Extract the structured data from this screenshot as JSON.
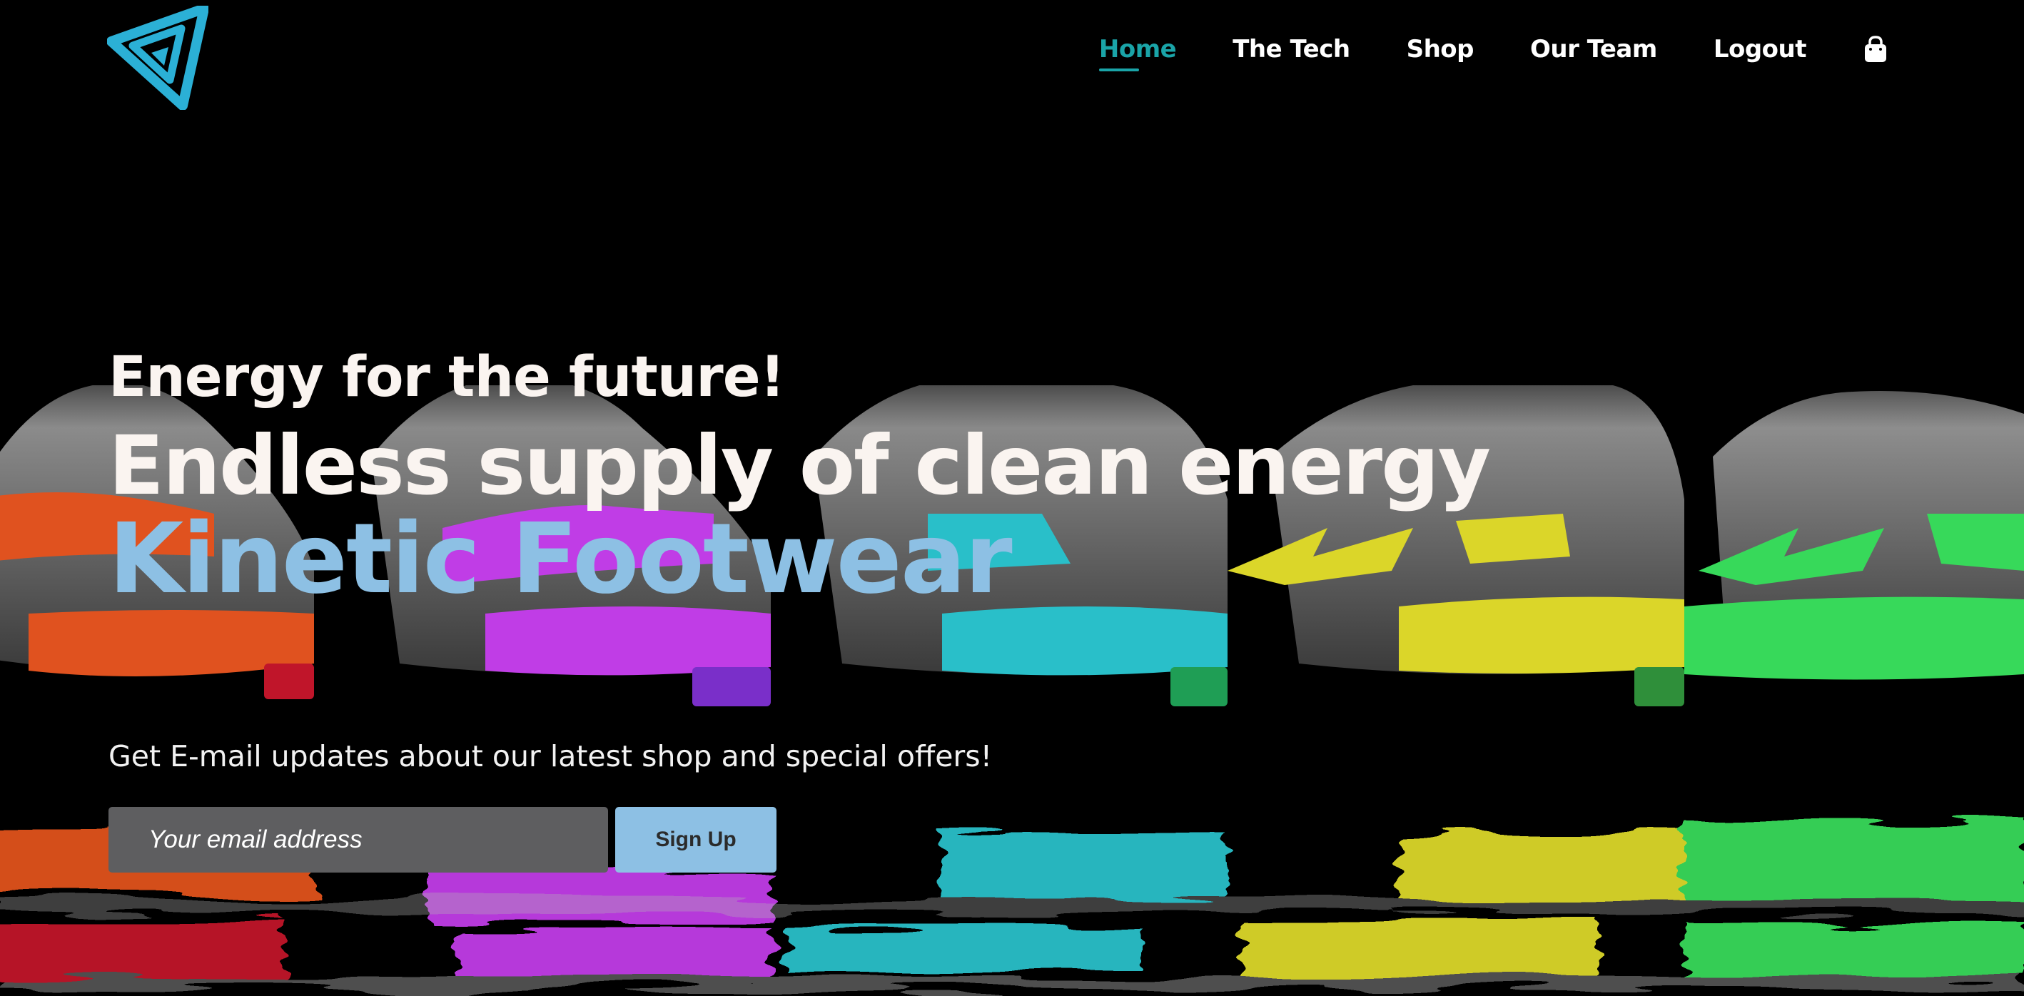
{
  "header": {
    "logo_icon": "triangle-swirl-logo",
    "nav": [
      {
        "label": "Home",
        "active": true
      },
      {
        "label": "The Tech",
        "active": false
      },
      {
        "label": "Shop",
        "active": false
      },
      {
        "label": "Our Team",
        "active": false
      },
      {
        "label": "Logout",
        "active": false
      }
    ],
    "cart_icon": "shopping-bag-icon"
  },
  "hero": {
    "tagline": "Energy for the future!",
    "headline": "Endless supply of clean energy",
    "brand": "Kinetic Footwear",
    "background_icon": "colorful-sneakers-reflection"
  },
  "newsletter": {
    "text": "Get E-mail updates about our latest shop and special offers!",
    "email_placeholder": "Your email address",
    "signup_label": "Sign Up"
  },
  "colors": {
    "accent_teal": "#1aa4a8",
    "brand_blue": "#8dc0e4",
    "background": "#000000",
    "input_gray": "#5e5e60",
    "shoe_colors": [
      "#e0521f",
      "#c03de6",
      "#29bfc9",
      "#dbd629",
      "#37d95a"
    ]
  }
}
